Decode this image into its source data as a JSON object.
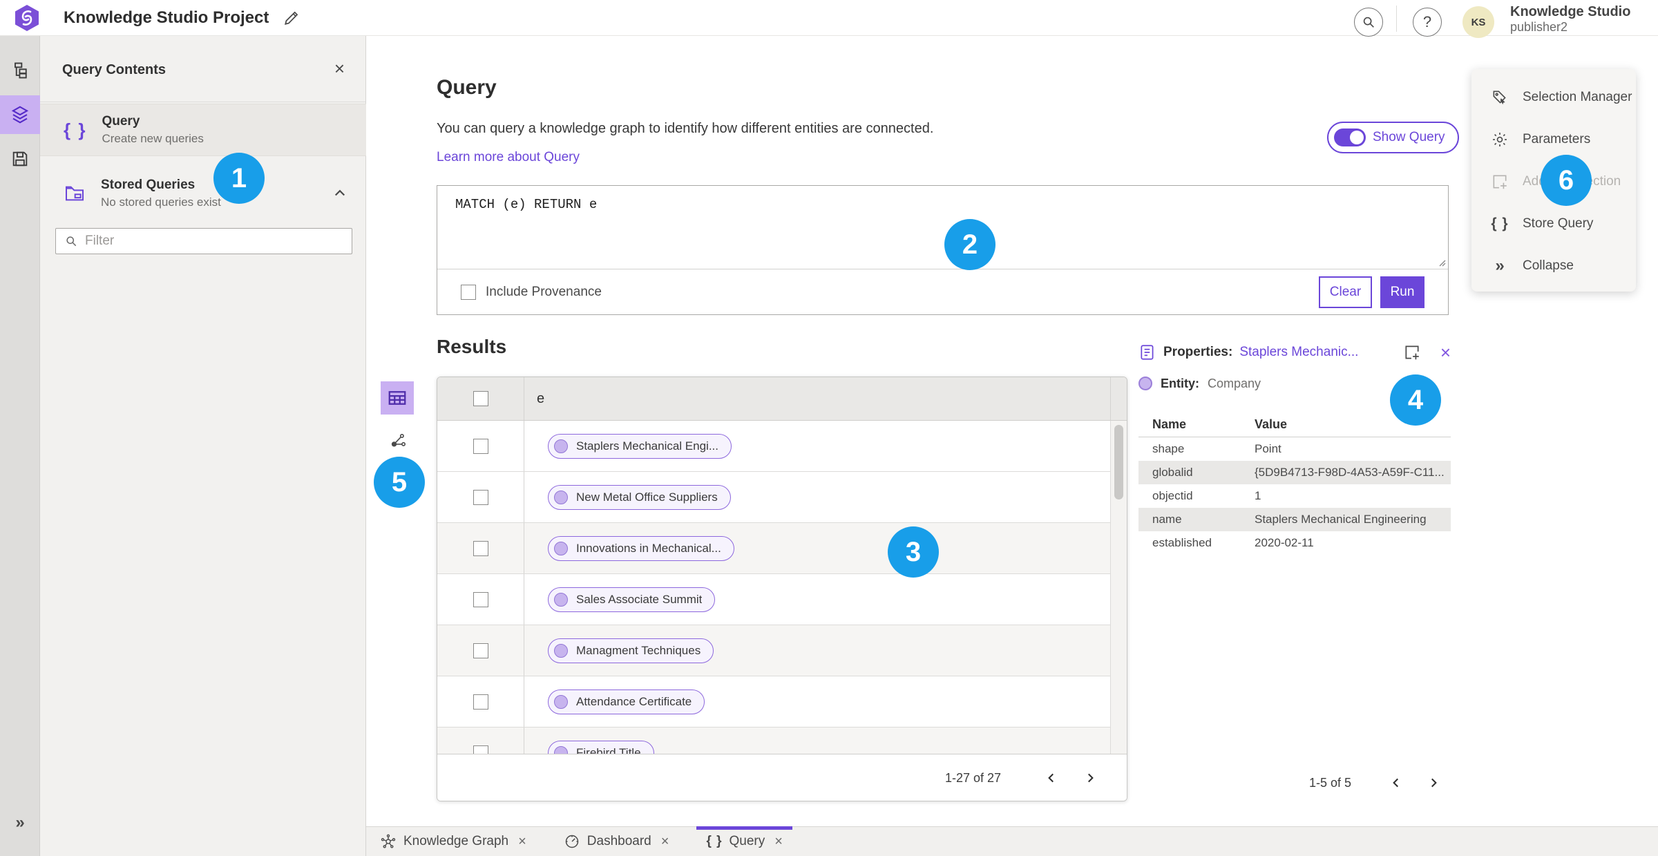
{
  "colors": {
    "accent_purple": "#6b46d9",
    "rail_active_purple": "#c9b0f2",
    "badge_blue": "#189ee9",
    "avatar_yellow": "#efe9c2"
  },
  "glyphs": {
    "braces": "{ }",
    "close": "×",
    "question": "?",
    "double_chevron_right": "»",
    "chevron_up_note": "^"
  },
  "topbar": {
    "title": "Knowledge Studio Project",
    "user_name": "Knowledge Studio",
    "user_role": "publisher2",
    "avatar_initials": "KS"
  },
  "query_contents": {
    "title": "Query Contents",
    "query_item": {
      "title": "Query",
      "subtitle": "Create new queries"
    },
    "stored_item": {
      "title": "Stored Queries",
      "subtitle": "No stored queries exist"
    },
    "filter_placeholder": "Filter"
  },
  "query": {
    "heading": "Query",
    "description": "You can query a knowledge graph to identify how different entities are connected.",
    "learn_more": "Learn more about Query",
    "show_query": "Show Query",
    "text": "MATCH (e) RETURN e",
    "include_provenance": "Include Provenance",
    "clear": "Clear",
    "run": "Run"
  },
  "results": {
    "heading": "Results",
    "column": "e",
    "rows": [
      "Staplers Mechanical Engi...",
      "New Metal Office Suppliers",
      "Innovations in Mechanical...",
      "Sales Associate Summit",
      "Managment Techniques",
      "Attendance Certificate",
      "Firebird Title"
    ],
    "pagination": "1-27 of 27"
  },
  "properties": {
    "label": "Properties:",
    "link": "Staplers Mechanic...",
    "entity_label": "Entity:",
    "entity_value": "Company",
    "col_name": "Name",
    "col_value": "Value",
    "rows": [
      {
        "name": "shape",
        "value": "Point"
      },
      {
        "name": "globalid",
        "value": "{5D9B4713-F98D-4A53-A59F-C11..."
      },
      {
        "name": "objectid",
        "value": "1"
      },
      {
        "name": "name",
        "value": "Staplers Mechanical Engineering"
      },
      {
        "name": "established",
        "value": "2020-02-11"
      }
    ],
    "pagination": "1-5 of 5"
  },
  "menu": {
    "items": [
      {
        "label": "Selection Manager"
      },
      {
        "label": "Parameters"
      },
      {
        "label": "Add To Selection"
      },
      {
        "label": "Store Query"
      },
      {
        "label": "Collapse"
      }
    ]
  },
  "tabs": {
    "items": [
      {
        "label": "Knowledge Graph"
      },
      {
        "label": "Dashboard"
      },
      {
        "label": "Query"
      }
    ]
  },
  "badges": [
    "1",
    "2",
    "3",
    "4",
    "5",
    "6"
  ]
}
